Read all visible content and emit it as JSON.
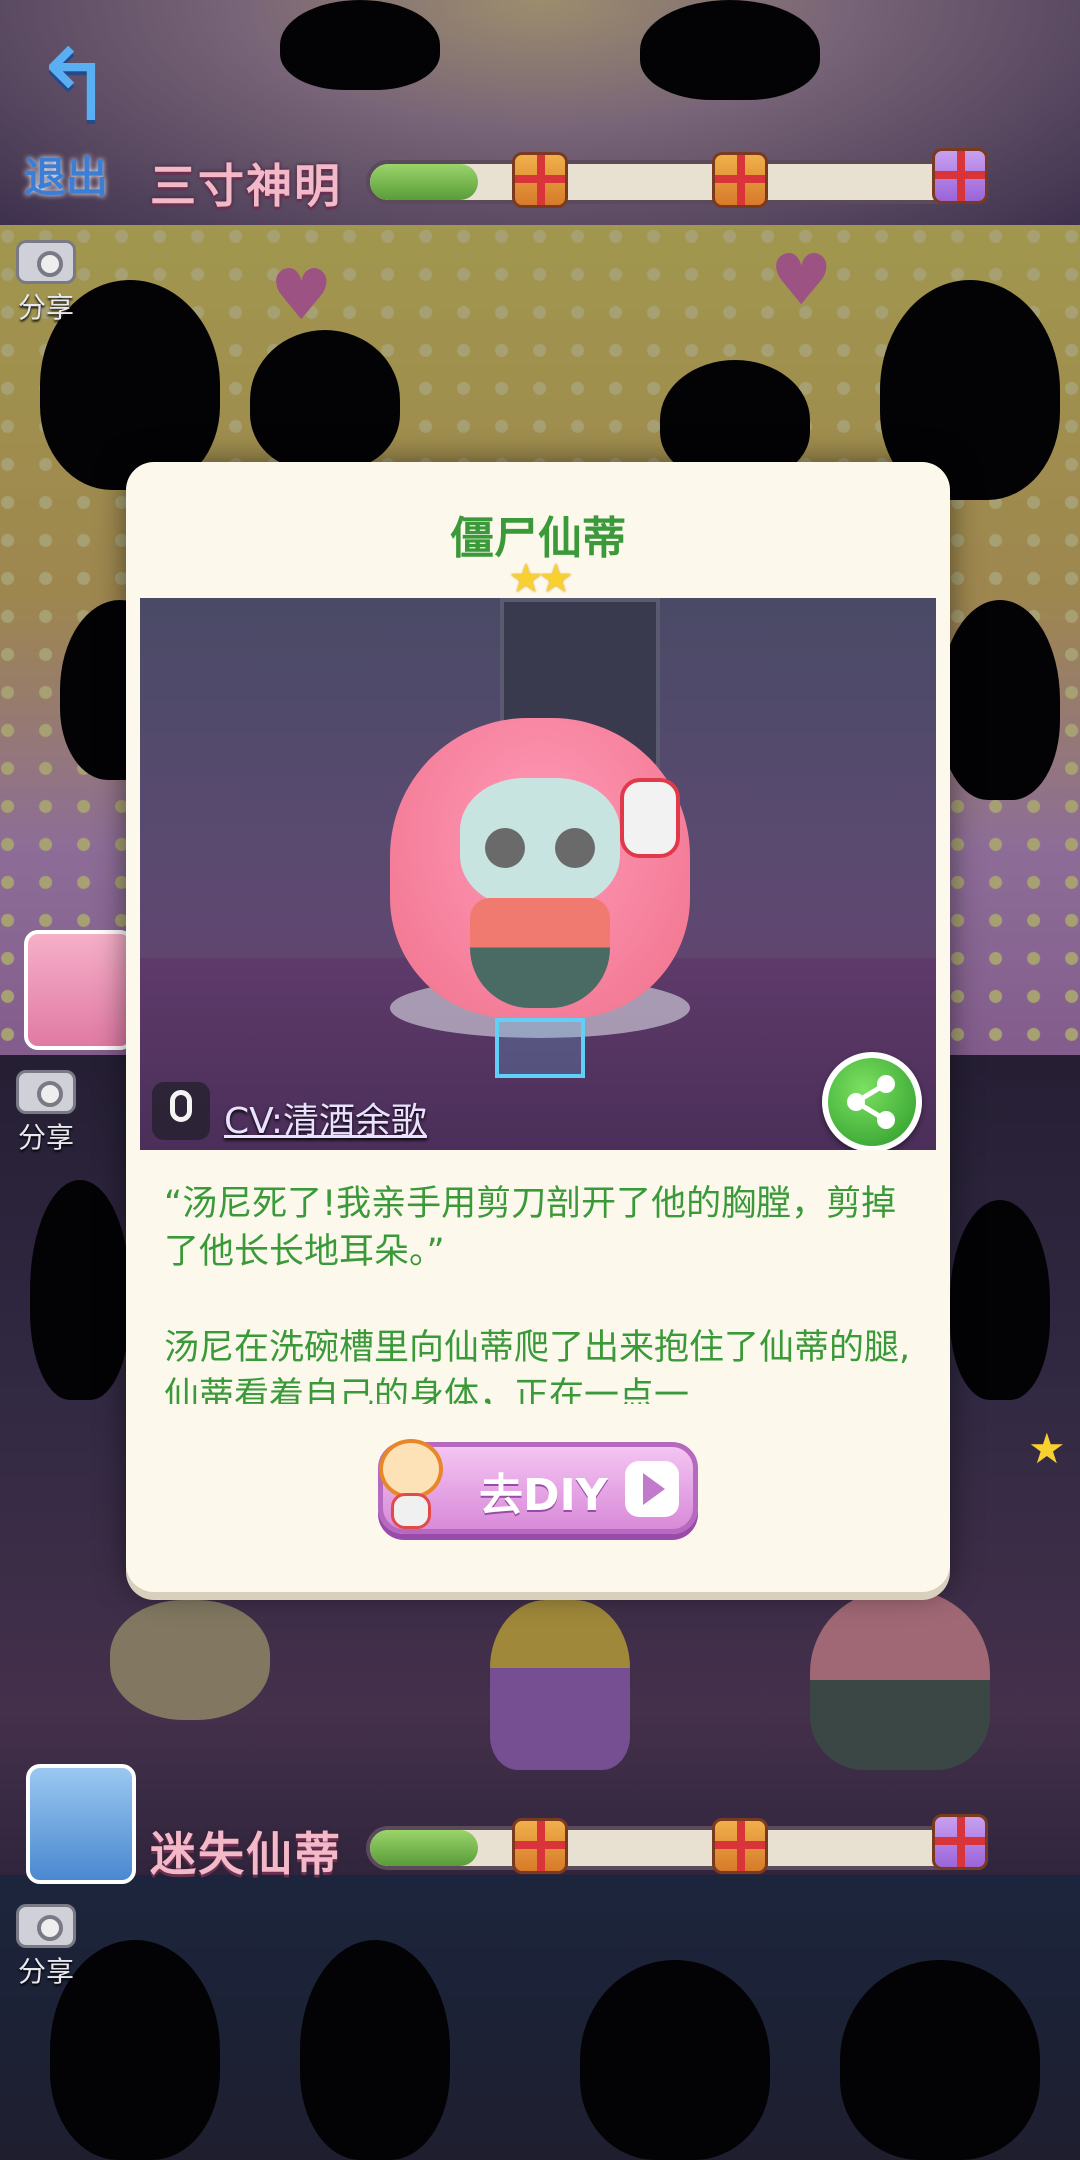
{
  "top_bar": {
    "back_label": "退出",
    "section_title": "三寸神明",
    "progress": 0.18
  },
  "sections": [
    {
      "share_label": "分享"
    },
    {
      "share_label": "分享"
    },
    {
      "share_label": "分享"
    }
  ],
  "bottom_bar": {
    "section_title": "迷失仙蒂",
    "progress": 0.18
  },
  "dialog": {
    "title": "僵尸仙蒂",
    "stars": 2,
    "stars_text": "★★",
    "cv_label": "CV:清酒余歌",
    "story_paragraphs": [
      "“汤尼死了!我亲手用剪刀剖开了他的胸膛，剪掉了他长长地耳朵。”",
      "汤尼在洗碗槽里向仙蒂爬了出来抱住了仙蒂的腿,仙蒂看着自己的身体，正在一点一"
    ],
    "diy_button": "去DIY"
  },
  "colors": {
    "accent_green": "#3a9a3a",
    "dialog_bg": "#fdf8ec",
    "diy_pink": "#d88ad8"
  },
  "icons": [
    "back-arrow-icon",
    "camera-icon",
    "gift-icon",
    "mic-icon",
    "share-icon",
    "play-icon",
    "star-icon"
  ]
}
